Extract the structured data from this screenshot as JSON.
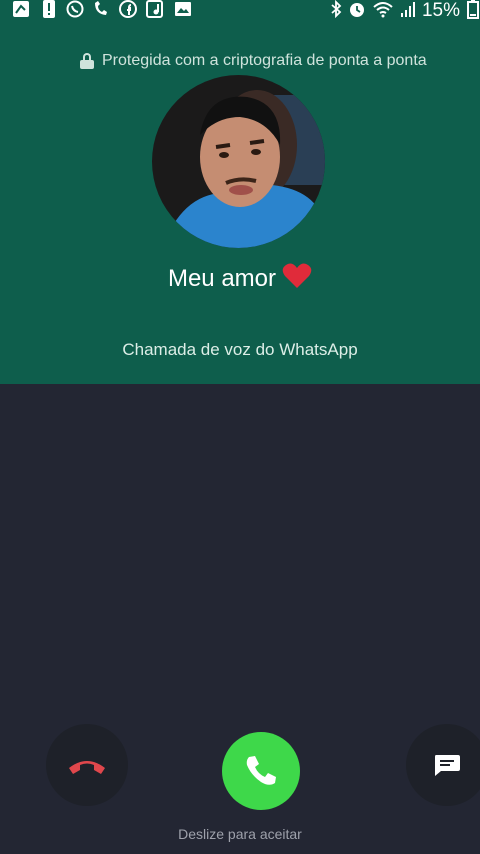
{
  "status_bar": {
    "battery_percent": "15%",
    "left_icons": [
      "notification-icon",
      "alert-icon",
      "whatsapp-icon",
      "missed-call-icon",
      "facebook-icon",
      "music-icon",
      "gallery-icon"
    ],
    "right_icons": [
      "bluetooth-icon",
      "alarm-icon",
      "wifi-icon",
      "signal-icon",
      "battery-icon"
    ]
  },
  "call": {
    "encryption_text": "Protegida com a criptografia de ponta a ponta",
    "caller_name": "Meu amor",
    "call_type": "Chamada de voz do WhatsApp",
    "swipe_hint": "Deslize para aceitar"
  },
  "colors": {
    "header_bg": "#0e5e4c",
    "body_bg": "#232633",
    "accept": "#3ed84a",
    "decline_icon": "#e0474c"
  }
}
